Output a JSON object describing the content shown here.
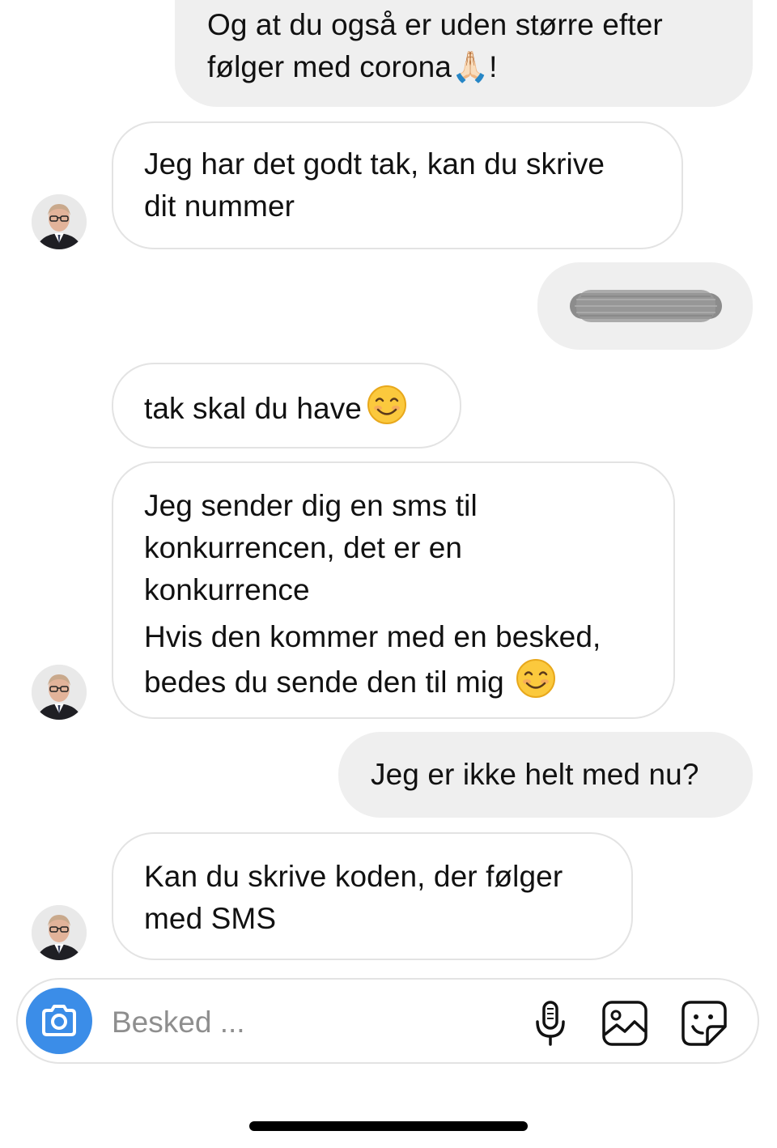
{
  "thread": {
    "messages": [
      {
        "direction": "outgoing",
        "lines": [
          "Og at du også er uden større efter",
          "følger med corona🙏🏻!"
        ]
      },
      {
        "direction": "incoming",
        "lines": [
          "Jeg har det godt tak, kan du skrive",
          "dit nummer"
        ]
      },
      {
        "direction": "outgoing",
        "redacted": true
      },
      {
        "direction": "incoming",
        "lines": [
          "tak skal du have"
        ],
        "emoji": "smiling-face-icon"
      },
      {
        "direction": "incoming",
        "lines": [
          "Jeg sender dig en sms til",
          "konkurrencen, det er en",
          "konkurrence",
          "Hvis den kommer med en besked,",
          "bedes du sende den til mig"
        ],
        "emoji": "smiling-face-icon"
      },
      {
        "direction": "outgoing",
        "lines": [
          "Jeg er ikke helt med nu?"
        ]
      },
      {
        "direction": "incoming",
        "lines": [
          "Kan du skrive koden, der følger",
          "med SMS"
        ]
      }
    ]
  },
  "composer": {
    "placeholder": "Besked ...",
    "icons": [
      "camera-icon",
      "microphone-icon",
      "gallery-icon",
      "sticker-icon"
    ]
  },
  "colors": {
    "outgoing_bubble": "#efefef",
    "incoming_border": "#e3e3e3",
    "camera_button": "#3b8de8",
    "placeholder_text": "#8e8e8e"
  }
}
